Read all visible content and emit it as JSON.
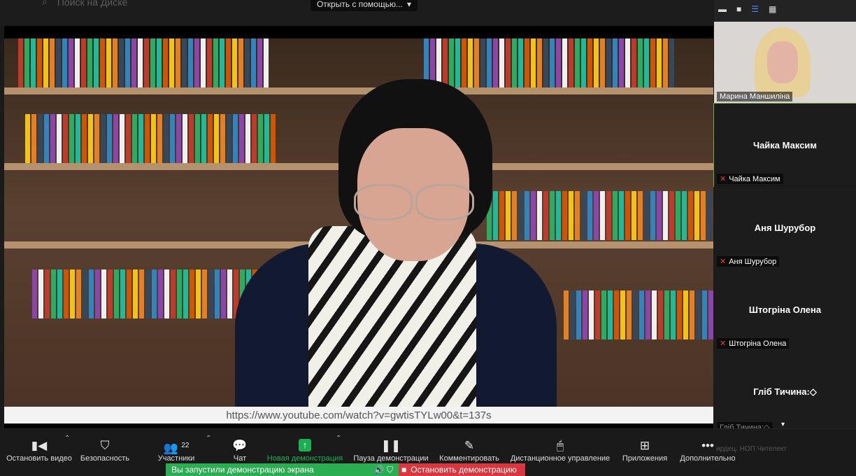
{
  "top": {
    "open_with": "Открыть с помощью...",
    "search_placeholder": "Поиск на Диске"
  },
  "shared_screen": {
    "url": "https://www.youtube.com/watch?v=gwtisTYLw00&t=137s"
  },
  "participants": [
    {
      "label": "Марина Маншиліна",
      "video": true
    },
    {
      "name_center": "Чайка Максим",
      "label": "Чайка Максим",
      "muted": true,
      "active": true
    },
    {
      "name_center": "Аня Шурубор",
      "label": "Аня Шурубор",
      "muted": true
    },
    {
      "name_center": "Штогріна Олена",
      "label": "Штогріна Олена",
      "muted": true
    },
    {
      "name_center": "Гліб Тичина:◇",
      "label": "Гліб Тичина:◇",
      "muted": true
    }
  ],
  "toolbar": {
    "stop_video": "Остановить видео",
    "security": "Безопасность",
    "participants": "Участники",
    "participants_count": "22",
    "chat": "Чат",
    "new_share": "Новая демонстрация",
    "pause_share": "Пауза демонстрации",
    "comment": "Комментировать",
    "remote_control": "Дистанционное управление",
    "apps": "Приложения",
    "more": "Дополнительно"
  },
  "status": {
    "sharing_message": "Вы запустили демонстрацию экрана",
    "stop_sharing": "Остановить демонстрацию"
  },
  "background": {
    "text": "ирдец. НОП Чителект"
  },
  "colors": {
    "green": "#19b053",
    "red": "#d9363e",
    "active_border": "#79a63f"
  }
}
